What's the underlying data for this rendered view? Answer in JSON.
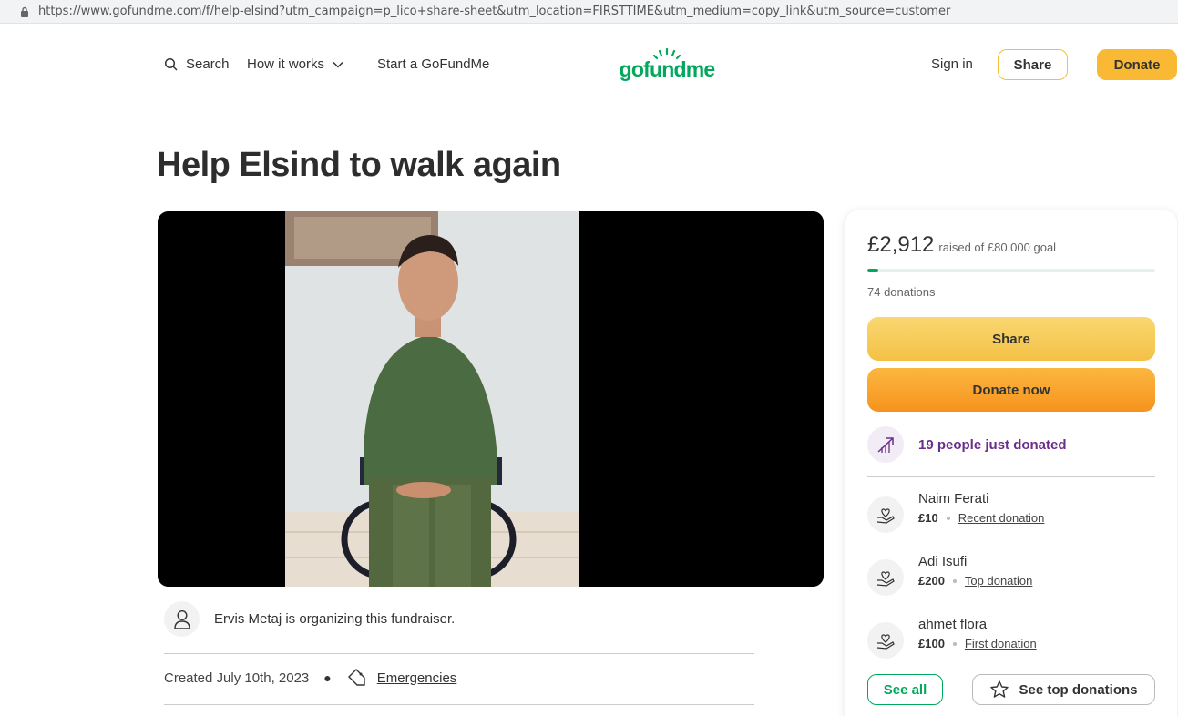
{
  "browser": {
    "url": "https://www.gofundme.com/f/help-elsind?utm_campaign=p_lico+share-sheet&utm_location=FIRSTTIME&utm_medium=copy_link&utm_source=customer"
  },
  "nav": {
    "search_label": "Search",
    "how_label": "How it works",
    "start_label": "Start a GoFundMe",
    "logo_text": "gofundme",
    "signin_label": "Sign in",
    "share_label": "Share",
    "donate_label": "Donate"
  },
  "campaign": {
    "title": "Help Elsind to walk again",
    "organizer_text": "Ervis Metaj is organizing this fundraiser.",
    "created": "Created July 10th, 2023",
    "category": "Emergencies"
  },
  "card": {
    "raised": "£2,912",
    "goal_text": "raised of £80,000 goal",
    "progress_fraction": 0.0364,
    "donations_count": "74 donations",
    "share_label": "Share",
    "donate_label": "Donate now",
    "trend_text": "19 people just donated",
    "donors": [
      {
        "name": "Naim Ferati",
        "amount": "£10",
        "type": "Recent donation"
      },
      {
        "name": "Adi Isufi",
        "amount": "£200",
        "type": "Top donation"
      },
      {
        "name": "ahmet flora",
        "amount": "£100",
        "type": "First donation"
      }
    ],
    "see_all_label": "See all",
    "see_top_label": "See top donations"
  },
  "colors": {
    "brand_green": "#02a95c",
    "donate_yellow": "#f9b935",
    "trend_purple": "#6b2d8c"
  }
}
